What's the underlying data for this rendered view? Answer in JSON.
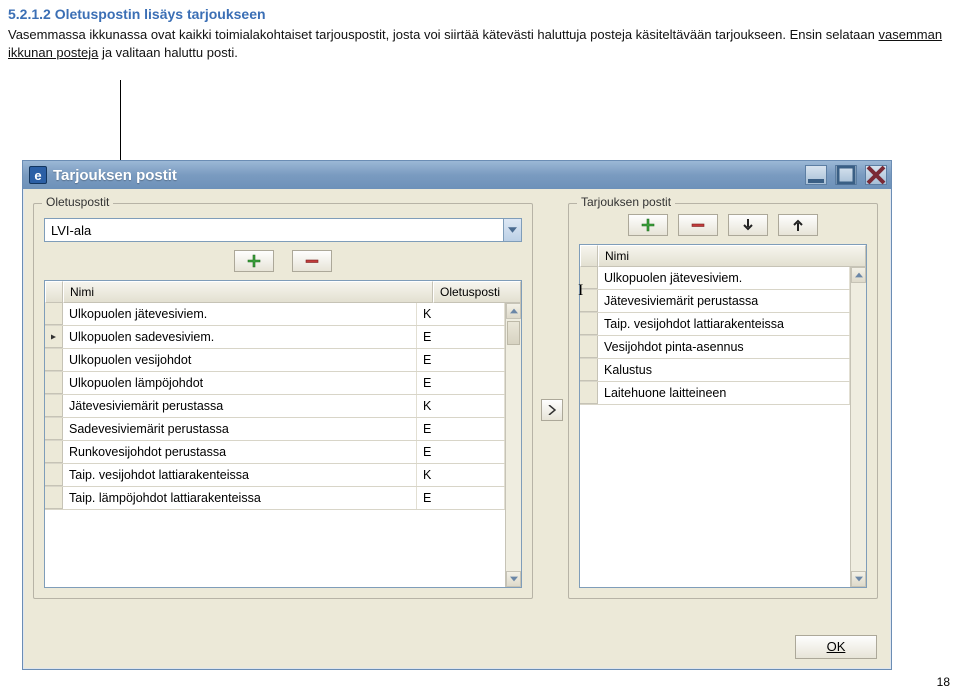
{
  "doc": {
    "heading": "5.2.1.2 Oletuspostin lisäys tarjoukseen",
    "para1a": "Vasemmassa ikkunassa ovat kaikki toimialakohtaiset tarjouspostit, josta voi siirtää kätevästi haluttuja posteja käsiteltävään tarjoukseen. Ensin selataan ",
    "para1b_u": "vasemman ikkunan posteja",
    "para1c": " ja valitaan haluttu posti.",
    "page": "18"
  },
  "window": {
    "title": "Tarjouksen postit",
    "app_icon": "e"
  },
  "left_group": {
    "title": "Oletuspostit"
  },
  "right_group": {
    "title": "Tarjouksen postit"
  },
  "combo": {
    "value": "LVI-ala"
  },
  "left_table": {
    "col1": "Nimi",
    "col2": "Oletusposti",
    "rows": [
      {
        "name": "Ulkopuolen jätevesiviem.",
        "def": "K",
        "sel": false
      },
      {
        "name": "Ulkopuolen sadevesiviem.",
        "def": "E",
        "sel": true
      },
      {
        "name": "Ulkopuolen vesijohdot",
        "def": "E",
        "sel": false
      },
      {
        "name": "Ulkopuolen lämpöjohdot",
        "def": "E",
        "sel": false
      },
      {
        "name": "Jätevesiviemärit perustassa",
        "def": "K",
        "sel": false
      },
      {
        "name": "Sadevesiviemärit perustassa",
        "def": "E",
        "sel": false
      },
      {
        "name": "Runkovesijohdot perustassa",
        "def": "E",
        "sel": false
      },
      {
        "name": "Taip. vesijohdot lattiarakenteissa",
        "def": "K",
        "sel": false
      },
      {
        "name": "Taip. lämpöjohdot lattiarakenteissa",
        "def": "E",
        "sel": false
      }
    ]
  },
  "right_table": {
    "col1": "Nimi",
    "rows": [
      {
        "name": "Ulkopuolen jätevesiviem."
      },
      {
        "name": "Jätevesiviemärit perustassa"
      },
      {
        "name": "Taip. vesijohdot lattiarakenteissa"
      },
      {
        "name": "Vesijohdot pinta-asennus"
      },
      {
        "name": "Kalustus"
      },
      {
        "name": "Laitehuone laitteineen"
      }
    ]
  },
  "buttons": {
    "ok": "OK"
  },
  "icons": {
    "plus": "plus-icon",
    "minus": "minus-icon",
    "arrow_down": "arrow-down-icon",
    "arrow_up": "arrow-up-icon",
    "chevron_right": "chevron-right-icon",
    "caret_down": "caret-down-icon",
    "scroll_up": "scroll-up-icon",
    "scroll_down": "scroll-down-icon",
    "select_marker": "row-marker-icon"
  }
}
